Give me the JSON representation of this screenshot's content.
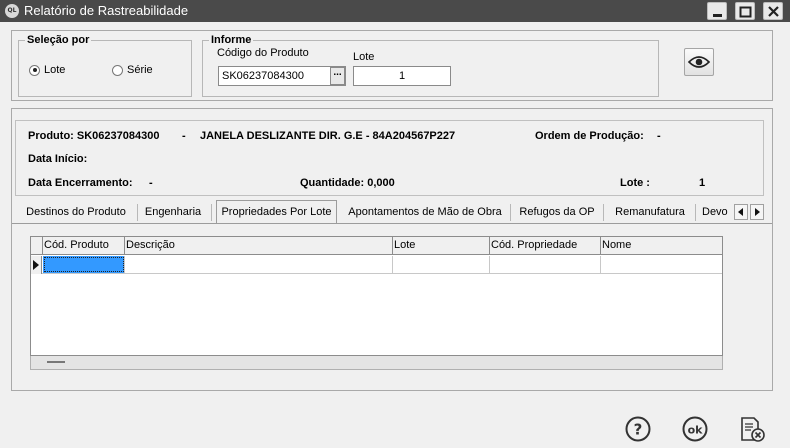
{
  "window": {
    "title": "Relatório de Rastreabilidade",
    "icon_text": "QL"
  },
  "selection": {
    "title": "Seleção por",
    "options": [
      {
        "label": "Lote",
        "selected": true
      },
      {
        "label": "Série",
        "selected": false
      }
    ]
  },
  "informe": {
    "title": "Informe",
    "product_code_label": "Código do Produto",
    "product_code_value": "SK06237084300",
    "lote_label": "Lote",
    "lote_value": "1",
    "ellipsis_label": "..."
  },
  "info": {
    "produto_label": "Produto: SK06237084300",
    "produto_sep": "-",
    "produto_desc": "JANELA DESLIZANTE DIR. G.E - 84A204567P227",
    "ordem_label": "Ordem de Produção:",
    "ordem_value": "-",
    "data_inicio_label": "Data Início:",
    "data_enc_label": "Data Encerramento:",
    "data_enc_value": "-",
    "quantidade_label": "Quantidade: 0,000",
    "lote_label": "Lote :",
    "lote_value": "1"
  },
  "tabs": [
    {
      "label": "Destinos do Produto",
      "active": false
    },
    {
      "label": "Engenharia",
      "active": false
    },
    {
      "label": "Propriedades Por Lote",
      "active": true
    },
    {
      "label": "Apontamentos de Mão de Obra",
      "active": false
    },
    {
      "label": "Refugos da OP",
      "active": false
    },
    {
      "label": "Remanufatura",
      "active": false
    },
    {
      "label": "Devo",
      "active": false
    }
  ],
  "grid": {
    "columns": [
      "Cód. Produto",
      "Descrição",
      "Lote",
      "Cód. Propriedade",
      "Nome"
    ]
  },
  "colors": {
    "titlebar": "#4a4a4a",
    "background": "#f0f0f0",
    "selected_cell": "#3399ff"
  },
  "icons": {
    "eye": "eye-icon",
    "help": "help-icon",
    "ok": "ok-icon",
    "report_close": "report-close-icon"
  }
}
